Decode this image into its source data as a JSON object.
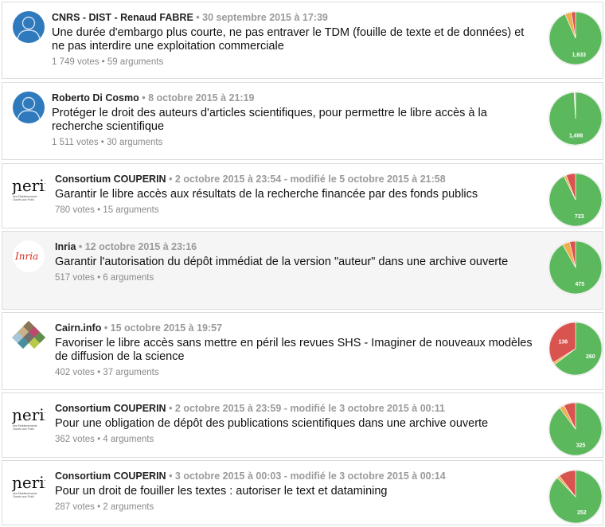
{
  "colors": {
    "pour": "#5cb85c",
    "mitige": "#f0ad4e",
    "contre": "#d9534f",
    "stroke": "#e6e6e6"
  },
  "items": [
    {
      "author": "CNRS - DIST - Renaud FABRE",
      "avatar": "user-silhouette-icon",
      "date": "30 septembre 2015 à 17:39",
      "title": "Une durée d'embargo plus courte, ne pas entraver le TDM (fouille de texte et de données) et ne pas interdire une exploitation commerciale",
      "votes": "1 749 votes",
      "arguments": "59 arguments",
      "pie": {
        "pour_fraction": 0.934,
        "mitige_fraction": 0.04,
        "contre_fraction": 0.026,
        "pour_label": "1,633",
        "contre_label": ""
      }
    },
    {
      "author": "Roberto Di Cosmo",
      "avatar": "user-silhouette-icon",
      "date": "8 octobre 2015 à 21:19",
      "title": "Protéger le droit des auteurs d'articles scientifiques, pour permettre le libre accès à la recherche scientifique",
      "votes": "1 511 votes",
      "arguments": "30 arguments",
      "pie": {
        "pour_fraction": 0.991,
        "mitige_fraction": 0.004,
        "contre_fraction": 0.005,
        "pour_label": "1,498",
        "contre_label": ""
      }
    },
    {
      "author": "Consortium COUPERIN",
      "avatar": "couperin-logo",
      "date": "2 octobre 2015 à 23:54 - modifié le 5 octobre 2015 à 21:58",
      "title": "Garantir le libre accès aux résultats de la recherche financée par des fonds publics",
      "votes": "780 votes",
      "arguments": "15 arguments",
      "pie": {
        "pour_fraction": 0.927,
        "mitige_fraction": 0.015,
        "contre_fraction": 0.058,
        "pour_label": "723",
        "contre_label": ""
      }
    },
    {
      "author": "Inria",
      "avatar": "inria-logo",
      "date": "12 octobre 2015 à 23:16",
      "title": "Garantir l'autorisation du dépôt immédiat de la version \"auteur\" dans une archive ouverte",
      "votes": "517 votes",
      "arguments": "6 arguments",
      "pie": {
        "pour_fraction": 0.919,
        "mitige_fraction": 0.045,
        "contre_fraction": 0.036,
        "pour_label": "475",
        "contre_label": ""
      }
    },
    {
      "author": "Cairn.info",
      "avatar": "cairn-logo",
      "date": "15 octobre 2015 à 19:57",
      "title": "Favoriser le libre accès sans mettre en péril les revues SHS - Imaginer de nouveaux modèles de diffusion de la science",
      "votes": "402 votes",
      "arguments": "37 arguments",
      "pie": {
        "pour_fraction": 0.647,
        "mitige_fraction": 0.015,
        "contre_fraction": 0.338,
        "pour_label": "260",
        "contre_label": "136"
      }
    },
    {
      "author": "Consortium COUPERIN",
      "avatar": "couperin-logo",
      "date": "2 octobre 2015 à 23:59 - modifié le 3 octobre 2015 à 00:11",
      "title": "Pour une obligation de dépôt des publications scientifiques dans une archive ouverte",
      "votes": "362 votes",
      "arguments": "4 arguments",
      "pie": {
        "pour_fraction": 0.898,
        "mitige_fraction": 0.03,
        "contre_fraction": 0.072,
        "pour_label": "325",
        "contre_label": ""
      }
    },
    {
      "author": "Consortium COUPERIN",
      "avatar": "couperin-logo",
      "date": "3 octobre 2015 à 00:03 - modifié le 3 octobre 2015 à 00:14",
      "title": "Pour un droit de fouiller les textes : autoriser le text et datamining",
      "votes": "287 votes",
      "arguments": "2 arguments",
      "pie": {
        "pour_fraction": 0.878,
        "mitige_fraction": 0.017,
        "contre_fraction": 0.105,
        "pour_label": "252",
        "contre_label": ""
      }
    }
  ]
}
